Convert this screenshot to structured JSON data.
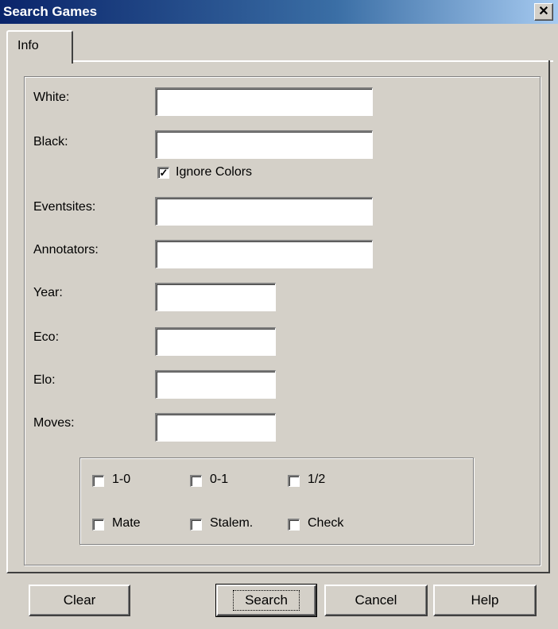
{
  "window": {
    "title": "Search Games",
    "close_glyph": "✕"
  },
  "tabs": [
    {
      "label": "Info"
    }
  ],
  "fields": {
    "white": {
      "label": "White:",
      "value": ""
    },
    "black": {
      "label": "Black:",
      "value": ""
    },
    "eventsites": {
      "label": "Eventsites:",
      "value": ""
    },
    "annotators": {
      "label": "Annotators:",
      "value": ""
    },
    "year": {
      "label": "Year:",
      "value": ""
    },
    "eco": {
      "label": "Eco:",
      "value": ""
    },
    "elo": {
      "label": "Elo:",
      "value": ""
    },
    "moves": {
      "label": "Moves:",
      "value": ""
    }
  },
  "ignore_colors": {
    "label": "Ignore Colors",
    "checked": true
  },
  "results": {
    "white_wins": {
      "label": "1-0",
      "checked": false
    },
    "black_wins": {
      "label": "0-1",
      "checked": false
    },
    "draw": {
      "label": "1/2",
      "checked": false
    },
    "mate": {
      "label": "Mate",
      "checked": false
    },
    "stalemate": {
      "label": "Stalem.",
      "checked": false
    },
    "check": {
      "label": "Check",
      "checked": false
    }
  },
  "buttons": {
    "clear": "Clear",
    "search": "Search",
    "cancel": "Cancel",
    "help": "Help"
  },
  "colors": {
    "titlebar_start": "#0a246a",
    "titlebar_end": "#a6caf0",
    "face": "#d4d0c8"
  }
}
